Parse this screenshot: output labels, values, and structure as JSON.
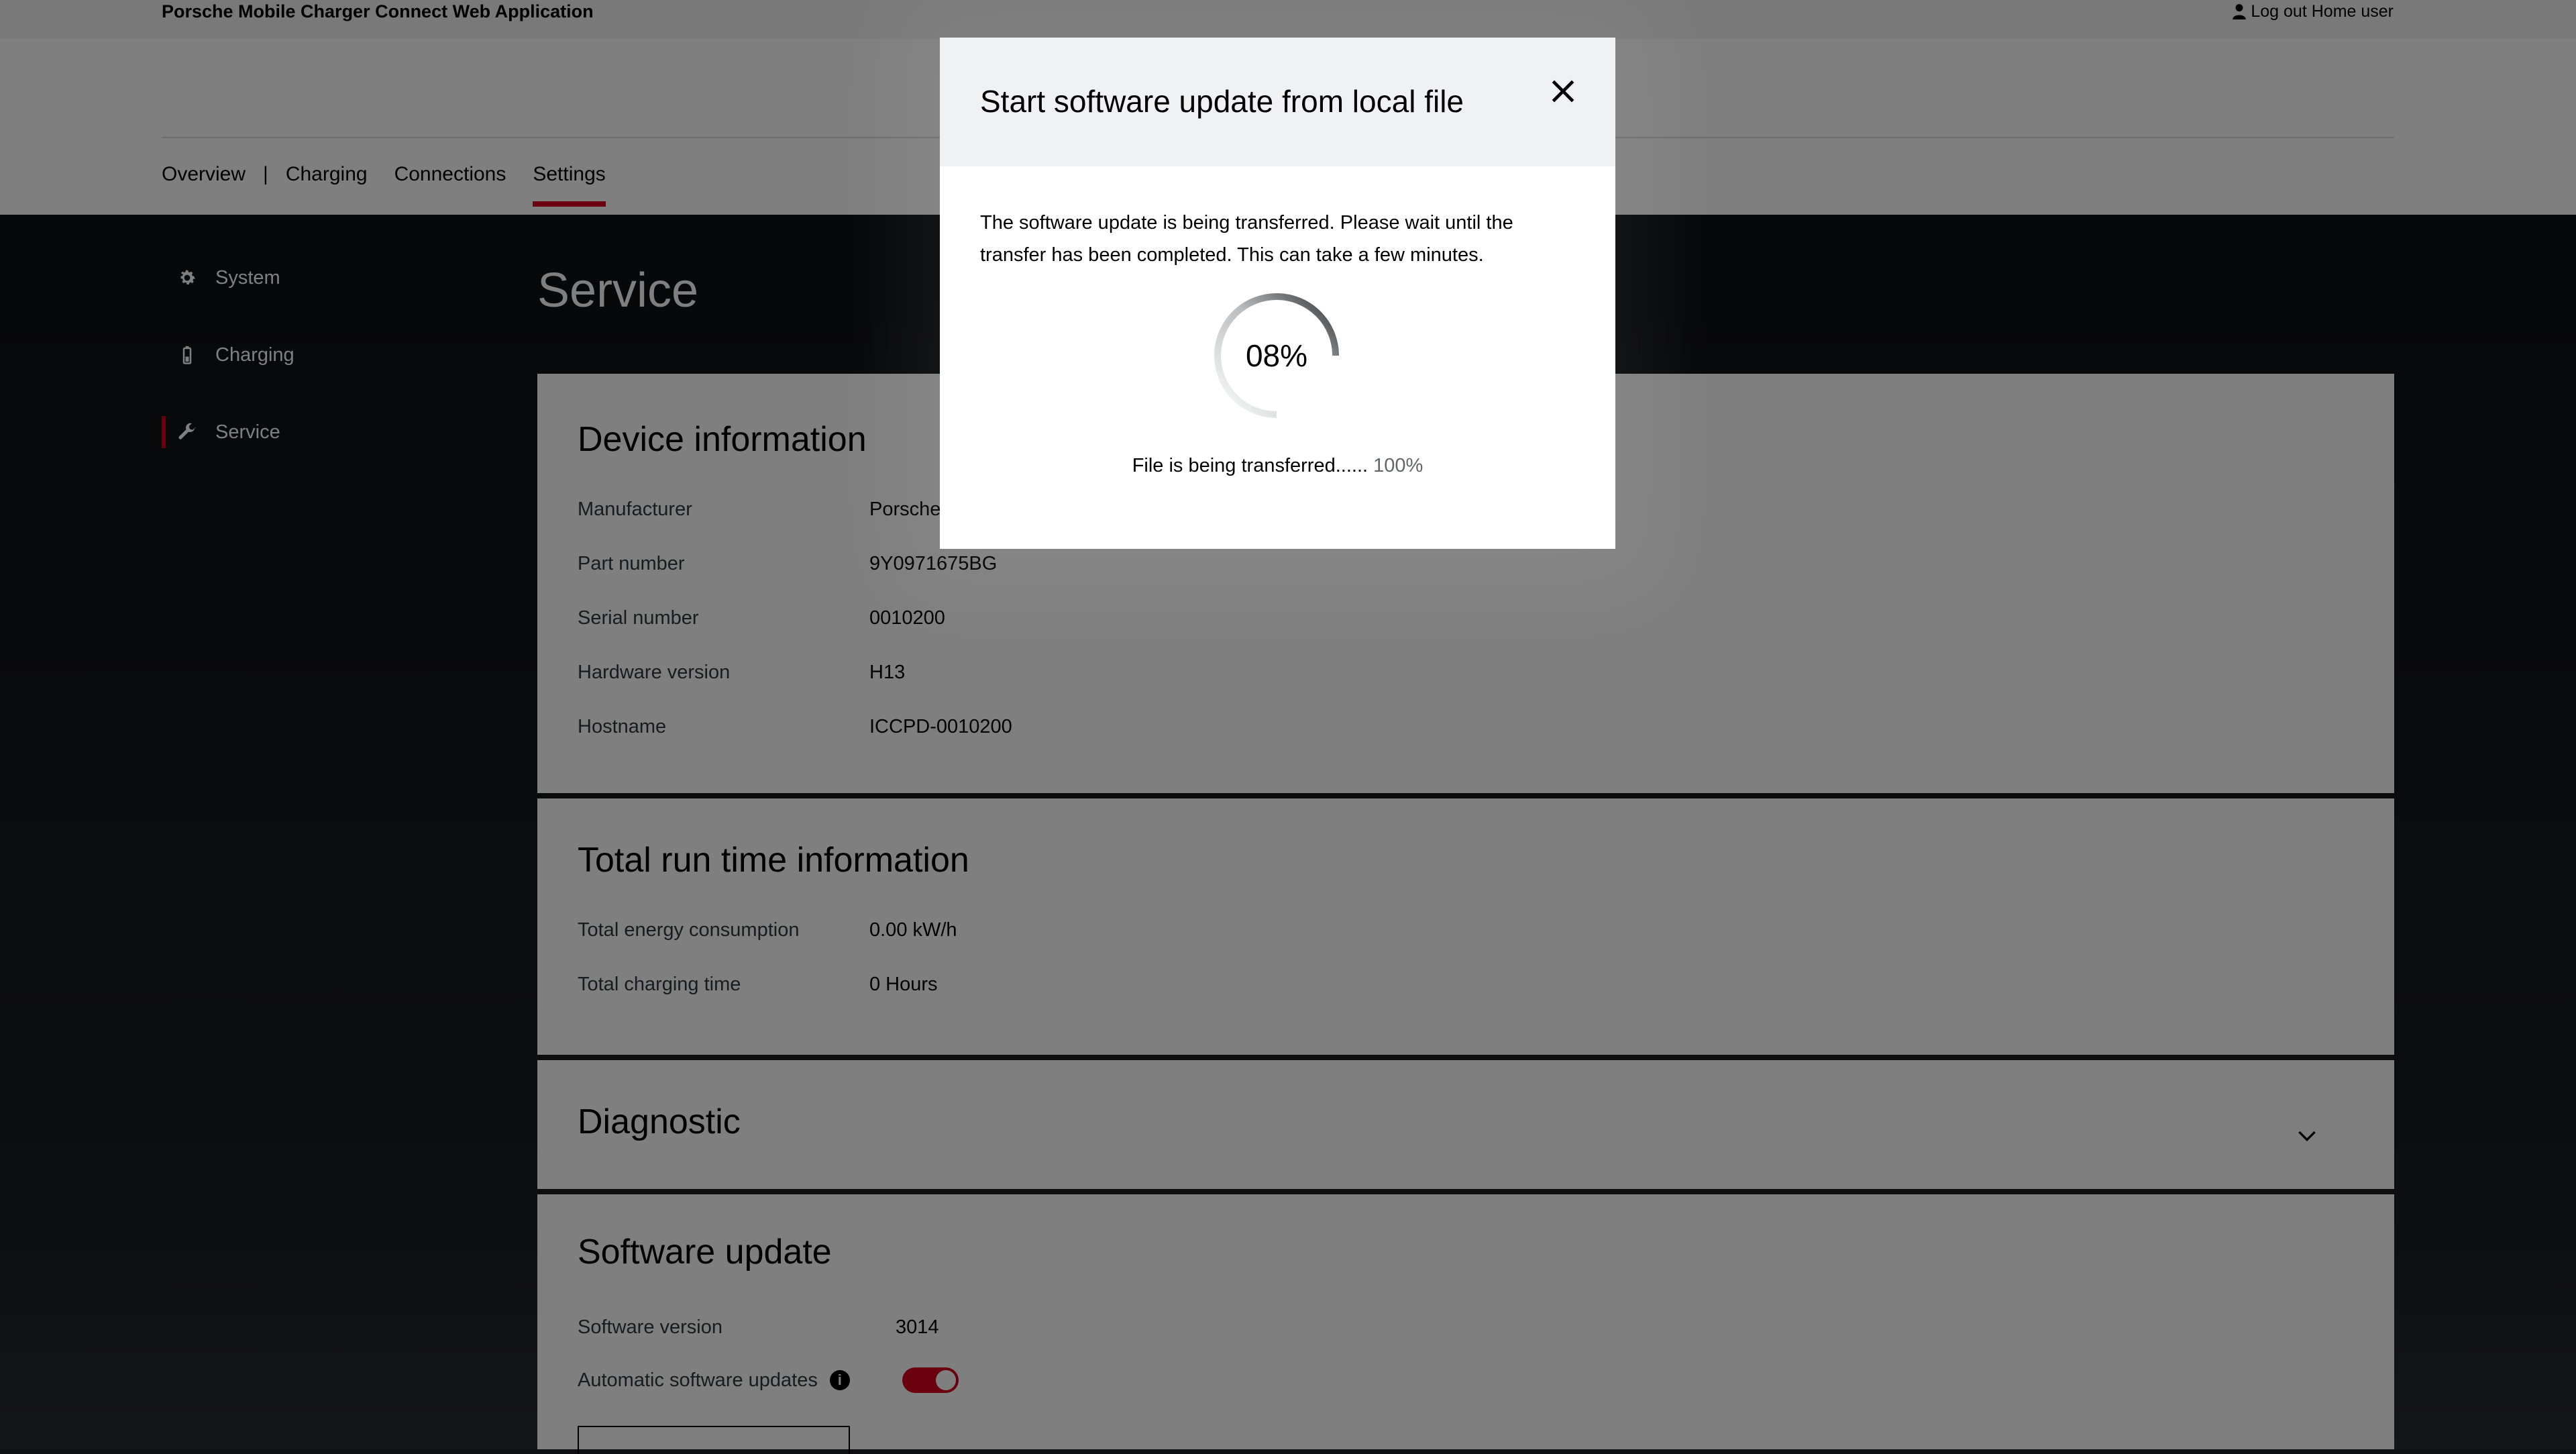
{
  "app": {
    "title": "Porsche Mobile Charger Connect Web Application",
    "logout_label": "Log out Home user"
  },
  "nav": {
    "items": [
      {
        "label": "Overview"
      },
      {
        "label": "Charging"
      },
      {
        "label": "Connections"
      },
      {
        "label": "Settings"
      }
    ],
    "separator": "|",
    "active": "Settings"
  },
  "sidebar": {
    "items": [
      {
        "label": "System",
        "icon": "gear-icon"
      },
      {
        "label": "Charging",
        "icon": "battery-icon"
      },
      {
        "label": "Service",
        "icon": "wrench-icon"
      }
    ],
    "active": "Service"
  },
  "page": {
    "title": "Service"
  },
  "device_info": {
    "title": "Device information",
    "rows": [
      {
        "label": "Manufacturer",
        "value": "Porsche"
      },
      {
        "label": "Part number",
        "value": "9Y0971675BG"
      },
      {
        "label": "Serial number",
        "value": "0010200"
      },
      {
        "label": "Hardware version",
        "value": "H13"
      },
      {
        "label": "Hostname",
        "value": "ICCPD-0010200"
      }
    ]
  },
  "runtime_info": {
    "title": "Total run time information",
    "rows": [
      {
        "label": "Total energy consumption",
        "value": "0.00 kW/h"
      },
      {
        "label": "Total charging time",
        "value": "0 Hours"
      }
    ]
  },
  "diagnostic": {
    "title": "Diagnostic"
  },
  "software_update": {
    "title": "Software update",
    "version_label": "Software version",
    "version_value": "3014",
    "auto_label": "Automatic software updates",
    "auto_enabled": true
  },
  "modal": {
    "title": "Start software update from local file",
    "message": "The software update is being transferred. Please wait until the transfer has been completed. This can take a few minutes.",
    "spinner_text": "08%",
    "status_label": "File is being transferred......",
    "status_percent": "100%"
  },
  "colors": {
    "accent": "#d5001c",
    "dark_background": "#0e1013"
  }
}
